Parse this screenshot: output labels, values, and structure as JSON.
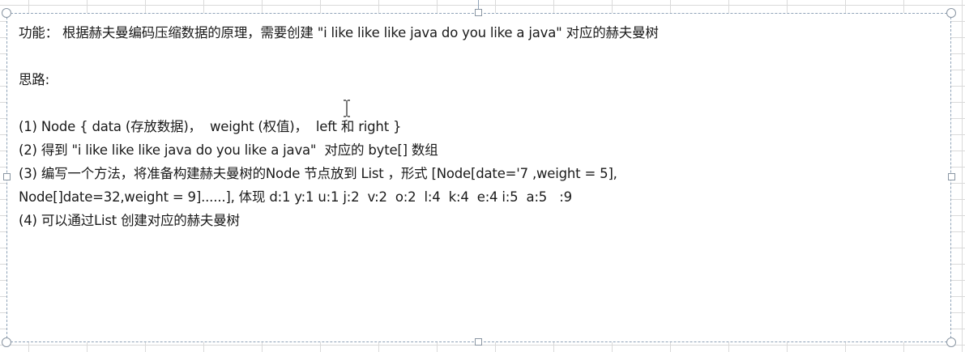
{
  "textbox": {
    "lines": [
      "功能： 根据赫夫曼编码压缩数据的原理，需要创建 \"i like like like java do you like a java\" 对应的赫夫曼树",
      "",
      "思路:",
      "",
      "(1) Node { data (存放数据)，  weight (权值)，  left 和 right }",
      "(2) 得到 \"i like like like java do you like a java\"  对应的 byte[] 数组",
      "(3) 编写一个方法，将准备构建赫夫曼树的Node 节点放到 List ，形式 [Node[date='7 ,weight = 5],",
      "Node[]date=32,weight = 9]......], 体现 d:1 y:1 u:1 j:2  v:2  o:2  l:4  k:4  e:4 i:5  a:5   :9",
      "(4) 可以通过List 创建对应的赫夫曼树"
    ]
  },
  "colors": {
    "selection_border": "#8fa3b8",
    "grid": "#dadada",
    "text": "#1a1a1a"
  },
  "icons": {
    "text_cursor": "i-beam-cursor-icon"
  }
}
